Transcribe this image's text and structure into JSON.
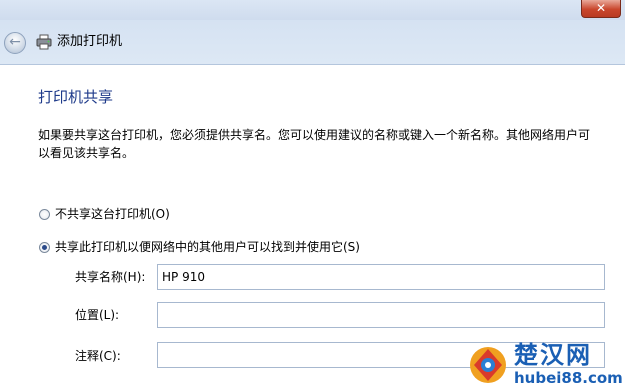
{
  "window": {
    "close_glyph": "✕"
  },
  "nav": {
    "back_glyph": "←",
    "title": "添加打印机",
    "icon": "printer-icon"
  },
  "section": {
    "title": "打印机共享",
    "description": "如果要共享这台打印机，您必须提供共享名。您可以使用建议的名称或键入一个新名称。其他网络用户可以看见该共享名。"
  },
  "options": [
    {
      "label": "不共享这台打印机(O)",
      "selected": false
    },
    {
      "label": "共享此打印机以便网络中的其他用户可以找到并使用它(S)",
      "selected": true
    }
  ],
  "fields": {
    "share_name": {
      "label": "共享名称(H):",
      "value": "HP 910"
    },
    "location": {
      "label": "位置(L):",
      "value": ""
    },
    "comment": {
      "label": "注释(C):",
      "value": ""
    }
  },
  "watermark": {
    "name": "楚汉网",
    "url": "hubei88.com"
  }
}
